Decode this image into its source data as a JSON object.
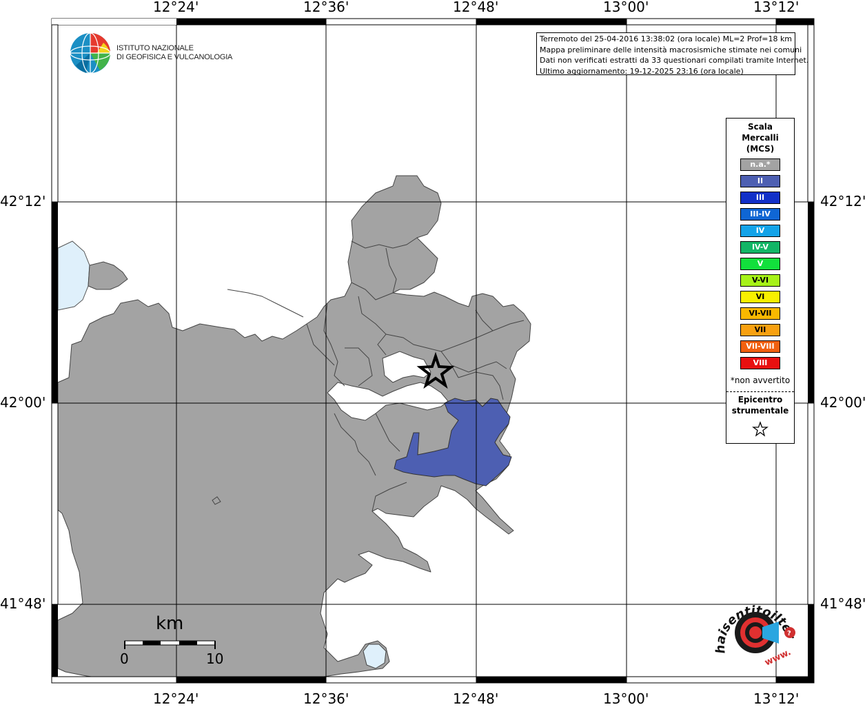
{
  "info": {
    "line1": "Terremoto del 25-04-2016 13:38:02 (ora locale) ML=2 Prof=18 km",
    "line2": "Mappa preliminare delle intensità macrosismiche stimate nei comuni",
    "line3": "Dati non verificati estratti da 33 questionari compilati tramite Internet.",
    "line4": "Ultimo aggiornamento: 19-12-2025 23:16 (ora locale)"
  },
  "logo": {
    "line1": "ISTITUTO NAZIONALE",
    "line2": "DI GEOFISICA E VULCANOLOGIA"
  },
  "axes": {
    "top": [
      "12°24'",
      "12°36'",
      "12°48'",
      "13°00'",
      "13°12'"
    ],
    "bottom": [
      "12°24'",
      "12°36'",
      "12°48'",
      "13°00'",
      "13°12'"
    ],
    "left": [
      "42°12'",
      "42°00'",
      "41°48'"
    ],
    "right": [
      "42°12'",
      "42°00'",
      "41°48'"
    ]
  },
  "legend": {
    "title_l1": "Scala",
    "title_l2": "Mercalli",
    "title_l3": "(MCS)",
    "items": [
      {
        "label": "n.a.*",
        "color": "#a3a3a3"
      },
      {
        "label": "II",
        "color": "#4d5fb2"
      },
      {
        "label": "III",
        "color": "#1230c8"
      },
      {
        "label": "III-IV",
        "color": "#0f66d4"
      },
      {
        "label": "IV",
        "color": "#13a3e8"
      },
      {
        "label": "IV-V",
        "color": "#12b666"
      },
      {
        "label": "V",
        "color": "#12e03c"
      },
      {
        "label": "V-VI",
        "color": "#a6f218"
      },
      {
        "label": "VI",
        "color": "#f8f000"
      },
      {
        "label": "VI-VII",
        "color": "#f8b800"
      },
      {
        "label": "VII",
        "color": "#f8a010"
      },
      {
        "label": "VII-VIII",
        "color": "#f06010"
      },
      {
        "label": "VIII",
        "color": "#e81010"
      }
    ],
    "note": "*non avvertito",
    "epi_l1": "Epicentro",
    "epi_l2": "strumentale"
  },
  "scale": {
    "unit": "km",
    "min": "0",
    "max": "10"
  },
  "hst": {
    "text": "haisentitoilterremoto.it",
    "url": "www."
  },
  "colors": {
    "land": "#a3a3a3",
    "intensity_ii": "#4d5fb2",
    "water": "#dff0fb"
  }
}
